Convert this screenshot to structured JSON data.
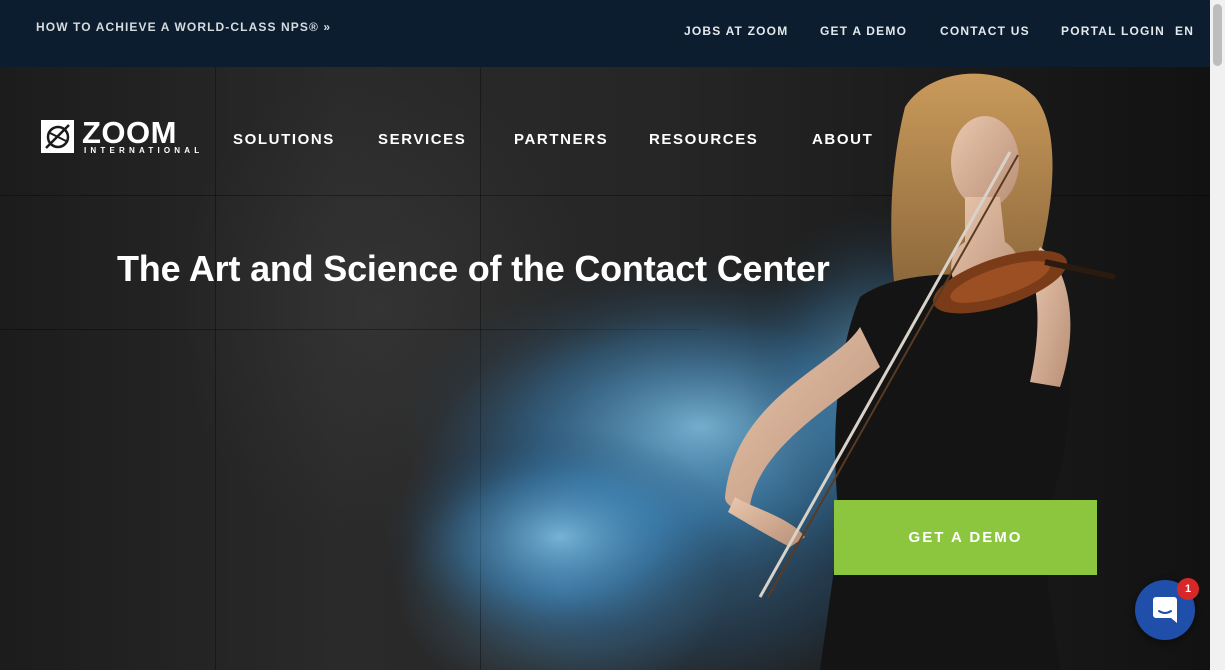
{
  "topbar": {
    "promo": "HOW TO ACHIEVE A WORLD-CLASS NPS® »",
    "links": [
      {
        "label": "JOBS AT ZOOM"
      },
      {
        "label": "GET A DEMO"
      },
      {
        "label": "CONTACT US"
      },
      {
        "label": "PORTAL LOGIN"
      },
      {
        "label": "EN"
      }
    ]
  },
  "logo": {
    "word": "ZOOM",
    "sub": "INTERNATIONAL"
  },
  "nav": [
    {
      "label": "SOLUTIONS"
    },
    {
      "label": "SERVICES"
    },
    {
      "label": "PARTNERS"
    },
    {
      "label": "RESOURCES"
    },
    {
      "label": "ABOUT"
    }
  ],
  "hero": {
    "headline": "The Art and Science of the Contact Center",
    "cta": "GET A DEMO"
  },
  "chat": {
    "badge": "1"
  },
  "colors": {
    "topbar": "#0b1d2e",
    "cta": "#8cc63f",
    "chat": "#1f4fa8",
    "badge": "#d62828"
  }
}
